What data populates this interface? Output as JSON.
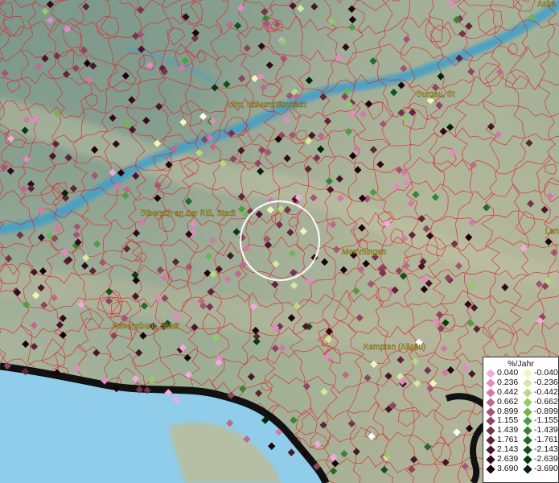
{
  "legend": {
    "title": "%/Jahr",
    "positive": [
      {
        "label": "0.040",
        "color": "#f2a9dc"
      },
      {
        "label": "0.236",
        "color": "#e28bc2"
      },
      {
        "label": "0.442",
        "color": "#d17aa6"
      },
      {
        "label": "0.662",
        "color": "#bd6a8b"
      },
      {
        "label": "0.899",
        "color": "#a55573"
      },
      {
        "label": "1.155",
        "color": "#8e4560"
      },
      {
        "label": "1.439",
        "color": "#76344c"
      },
      {
        "label": "1.761",
        "color": "#5e2438"
      },
      {
        "label": "2.143",
        "color": "#481626"
      },
      {
        "label": "2.639",
        "color": "#320a16"
      },
      {
        "label": "3.690",
        "color": "#1c0208"
      }
    ],
    "negative": [
      {
        "label": "-0.040",
        "color": "#f0f7b8"
      },
      {
        "label": "-0.236",
        "color": "#d3eb9c"
      },
      {
        "label": "-0.442",
        "color": "#b5db82"
      },
      {
        "label": "-0.662",
        "color": "#94c96a"
      },
      {
        "label": "-0.899",
        "color": "#70b554"
      },
      {
        "label": "-1.155",
        "color": "#4f9e42"
      },
      {
        "label": "-1.439",
        "color": "#358534"
      },
      {
        "label": "-1.761",
        "color": "#216b29"
      },
      {
        "label": "-2.143",
        "color": "#12521f"
      },
      {
        "label": "-2.639",
        "color": "#083a15"
      },
      {
        "label": "-3.690",
        "color": "#02240b"
      }
    ]
  },
  "cities": [
    {
      "name": "Ulm, Universitätsstadt"
    },
    {
      "name": "Burgau, St"
    },
    {
      "name": "Biberach an der Riß, Stadt"
    },
    {
      "name": "Memmingen"
    },
    {
      "name": "Ravensburg, Stadt"
    },
    {
      "name": "Kempten (Allgäu)"
    },
    {
      "name": "Asba"
    },
    {
      "name": "Lan"
    }
  ],
  "colors": {
    "boundary": "#e0242a",
    "river": "#3f9fc9",
    "lake": "#8fcdea",
    "relief": "#8fa896",
    "label": "#e6d23c",
    "selection_circle": "#ffffff"
  }
}
